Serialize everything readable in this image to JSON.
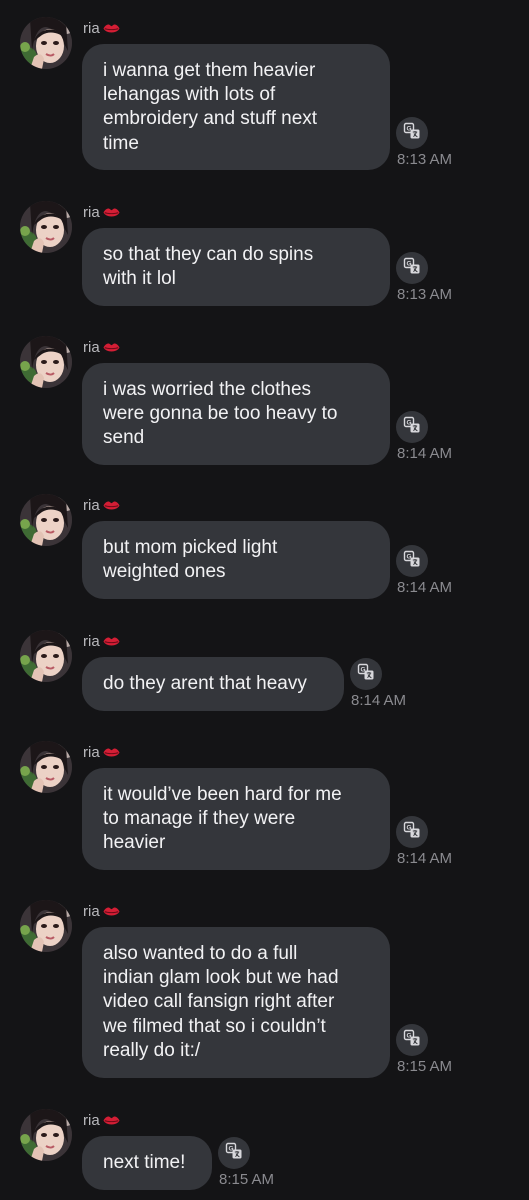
{
  "chat": {
    "messages": [
      {
        "sender": "ria",
        "lines": [
          "i wanna get them heavier",
          "lehangas with lots of",
          "embroidery and stuff next",
          "time"
        ],
        "time": "8:13 AM",
        "icons": {
          "avatar": "profile-photo",
          "sender_badge": "lips-icon",
          "action": "translate-icon"
        }
      },
      {
        "sender": "ria",
        "lines": [
          "so that they can do spins",
          "with it lol"
        ],
        "time": "8:13 AM",
        "icons": {
          "avatar": "profile-photo",
          "sender_badge": "lips-icon",
          "action": "translate-icon"
        }
      },
      {
        "sender": "ria",
        "lines": [
          "i was worried the clothes",
          "were gonna be too heavy to",
          "send"
        ],
        "time": "8:14 AM",
        "icons": {
          "avatar": "profile-photo",
          "sender_badge": "lips-icon",
          "action": "translate-icon"
        }
      },
      {
        "sender": "ria",
        "lines": [
          "but mom picked light",
          "weighted ones"
        ],
        "time": "8:14 AM",
        "icons": {
          "avatar": "profile-photo",
          "sender_badge": "lips-icon",
          "action": "translate-icon"
        }
      },
      {
        "sender": "ria",
        "lines": [
          "do they arent that heavy"
        ],
        "time": "8:14 AM",
        "icons": {
          "avatar": "profile-photo",
          "sender_badge": "lips-icon",
          "action": "translate-icon"
        }
      },
      {
        "sender": "ria",
        "lines": [
          "it would’ve been hard for me",
          "to manage if they were",
          "heavier"
        ],
        "time": "8:14 AM",
        "icons": {
          "avatar": "profile-photo",
          "sender_badge": "lips-icon",
          "action": "translate-icon"
        }
      },
      {
        "sender": "ria",
        "lines": [
          "also wanted to do a full",
          "indian glam look but we had",
          "video call fansign right after",
          "we filmed that so i couldn’t",
          "really do it:/"
        ],
        "time": "8:15 AM",
        "icons": {
          "avatar": "profile-photo",
          "sender_badge": "lips-icon",
          "action": "translate-icon"
        }
      },
      {
        "sender": "ria",
        "lines": [
          "next time!"
        ],
        "time": "8:15 AM",
        "icons": {
          "avatar": "profile-photo",
          "sender_badge": "lips-icon",
          "action": "translate-icon"
        }
      }
    ]
  },
  "colors": {
    "background": "#141416",
    "bubble": "#34363b",
    "text": "#f2f2f4",
    "sender_name": "#b9b9bd",
    "timestamp": "#8a8a8f",
    "lips_badge": "#d41e35"
  }
}
